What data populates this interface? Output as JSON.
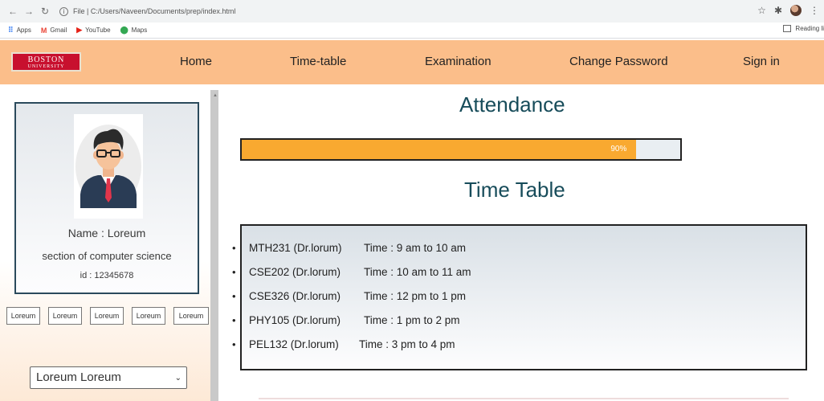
{
  "browser": {
    "address": "File | C:/Users/Naveen/Documents/prep/index.html",
    "bookmarks": [
      "Apps",
      "Gmail",
      "YouTube",
      "Maps"
    ],
    "reading_list": "Reading li"
  },
  "site": {
    "logo_line1": "BOSTON",
    "logo_line2": "UNIVERSITY",
    "nav": [
      "Home",
      "Time-table",
      "Examination",
      "Change Password",
      "Sign in"
    ]
  },
  "profile": {
    "name": "Name : Loreum",
    "section": "section of computer science",
    "id": "id : 12345678"
  },
  "buttons": [
    "Loreum",
    "Loreum",
    "Loreum",
    "Loreum",
    "Loreum"
  ],
  "dropdown": {
    "selected": "Loreum Loreum"
  },
  "attendance": {
    "title": "Attendance",
    "percent": 90,
    "label": "90%"
  },
  "timetable": {
    "title": "Time Table",
    "items": [
      {
        "course": "MTH231 (Dr.lorum)",
        "time": "Time : 9 am to 10 am"
      },
      {
        "course": "CSE202 (Dr.lorum)",
        "time": "Time : 10 am to 11 am"
      },
      {
        "course": "CSE326 (Dr.lorum)",
        "time": "Time : 12 pm to 1 pm"
      },
      {
        "course": "PHY105 (Dr.lorum)",
        "time": "Time : 1 pm to 2 pm"
      },
      {
        "course": "PEL132 (Dr.lorum)",
        "time": "Time : 3 pm to 4 pm"
      }
    ]
  }
}
